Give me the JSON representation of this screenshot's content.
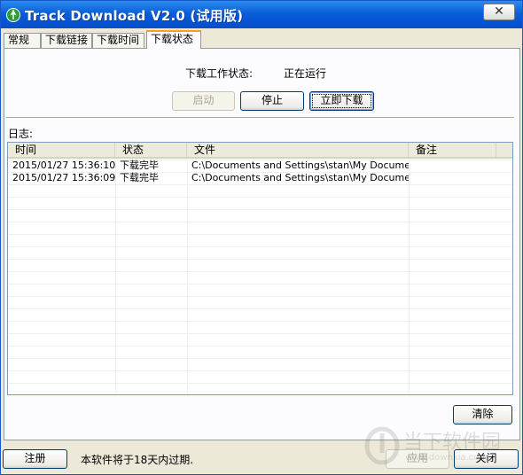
{
  "window": {
    "title": "Track Download V2.0 (试用版)",
    "close_label": "✕"
  },
  "tabs": [
    "常规",
    "下载链接",
    "下载时间",
    "下载状态"
  ],
  "status": {
    "label": "下载工作状态:",
    "value": "正在运行"
  },
  "buttons": {
    "start": "启动",
    "stop": "停止",
    "download_now": "立即下载",
    "clear": "清除",
    "register": "注册",
    "apply": "应用",
    "close": "关闭"
  },
  "log": {
    "label": "日志:",
    "columns": [
      "时间",
      "状态",
      "文件",
      "备注"
    ],
    "rows": [
      {
        "time": "2015/01/27 15:36:10",
        "state": "下载完毕",
        "file": "C:\\Documents and Settings\\stan\\My Document...",
        "note": ""
      },
      {
        "time": "2015/01/27 15:36:09",
        "state": "下载完毕",
        "file": "C:\\Documents and Settings\\stan\\My Document...",
        "note": ""
      }
    ]
  },
  "footer": {
    "expiry": "本软件将于18天内过期."
  },
  "watermark": {
    "text": "当下软件园",
    "url": "www.downxia.com"
  }
}
